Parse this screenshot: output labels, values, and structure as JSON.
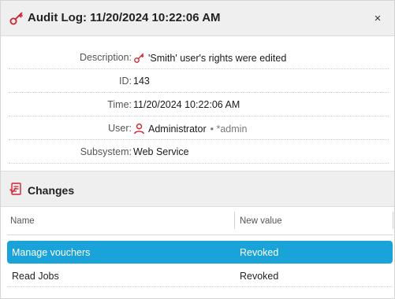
{
  "window": {
    "title": "Audit Log: 11/20/2024 10:22:06 AM",
    "close_glyph": "×"
  },
  "details": [
    {
      "label": "Description:",
      "value": "'Smith' user's rights were edited",
      "icon": "key-icon"
    },
    {
      "label": "ID:",
      "value": "143"
    },
    {
      "label": "Time:",
      "value": "11/20/2024 10:22:06 AM"
    },
    {
      "label": "User:",
      "value": "Administrator",
      "secondary": "• *admin",
      "icon": "user-icon"
    },
    {
      "label": "Subsystem:",
      "value": "Web Service"
    }
  ],
  "changes": {
    "title": "Changes",
    "columns": [
      "Name",
      "New value"
    ],
    "rows": [
      {
        "name": "Manage vouchers",
        "new_value": "Revoked",
        "selected": true
      },
      {
        "name": "Read Jobs",
        "new_value": "Revoked",
        "selected": false
      }
    ]
  },
  "colors": {
    "accent_red": "#d0202f",
    "selection": "#19a3d8"
  }
}
